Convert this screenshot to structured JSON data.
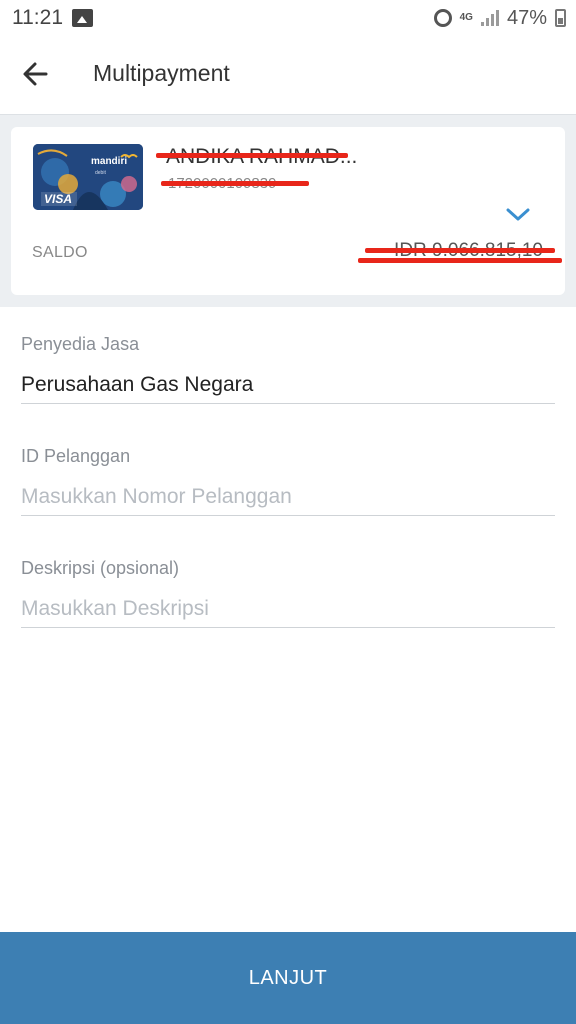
{
  "status_bar": {
    "time": "11:21",
    "network": "4G",
    "battery": "47%"
  },
  "app_bar": {
    "title": "Multipayment",
    "back_icon": "arrow-left-icon"
  },
  "account_card": {
    "card_brand": "mandiri",
    "card_type": "debit",
    "card_network": "VISA",
    "account_name": "ANDIKA RAHMAD...",
    "account_number": "1720000109839",
    "balance_label": "SALDO",
    "balance_value": "IDR 9.066.815,10",
    "expand_icon": "chevron-down-icon",
    "redaction_color": "#e8261a"
  },
  "form": {
    "provider": {
      "label": "Penyedia Jasa",
      "value": "Perusahaan Gas Negara"
    },
    "customer_id": {
      "label": "ID Pelanggan",
      "placeholder": "Masukkan Nomor Pelanggan"
    },
    "description": {
      "label": "Deskripsi (opsional)",
      "placeholder": "Masukkan Deskripsi"
    }
  },
  "submit": {
    "label": "LANJUT",
    "color": "#3d7fb3"
  }
}
